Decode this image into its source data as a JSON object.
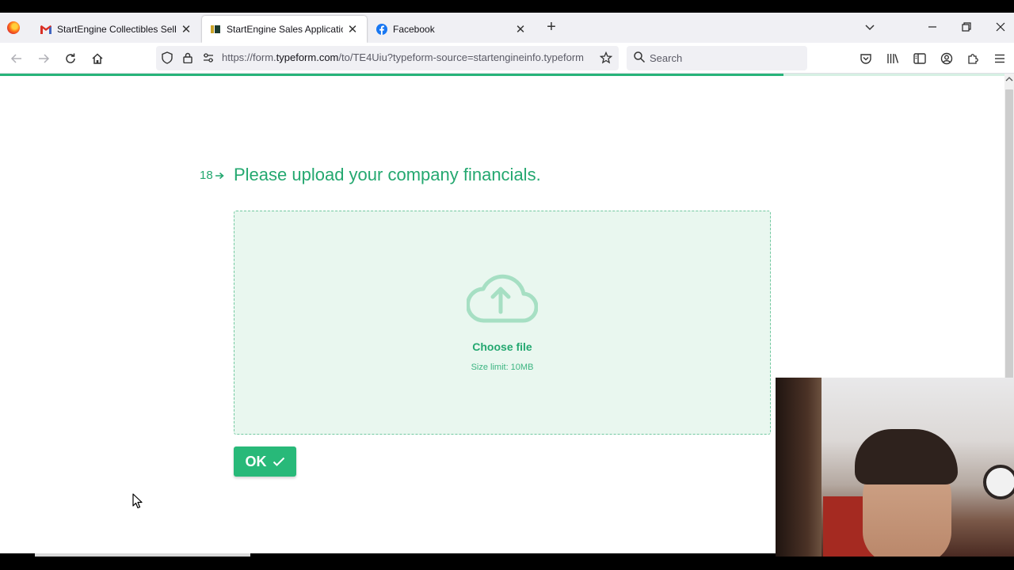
{
  "browser": {
    "tabs": [
      {
        "title": "StartEngine Collectibles Selling",
        "favicon": "gmail-icon"
      },
      {
        "title": "StartEngine Sales Application",
        "favicon": "startengine-icon"
      },
      {
        "title": "Facebook",
        "favicon": "facebook-icon"
      }
    ],
    "url": {
      "prefix": "https://form.",
      "host": "typeform.com",
      "path": "/to/TE4Uiu?typeform-source=startengineinfo.typeform"
    },
    "search_placeholder": "Search"
  },
  "form": {
    "progress_fraction": 0.78,
    "question_number": "18",
    "question_title": "Please upload your company financials.",
    "upload": {
      "choose_label": "Choose file",
      "size_limit": "Size limit: 10MB"
    },
    "ok_label": "OK"
  },
  "colors": {
    "accent": "#24a870",
    "dropzone_bg": "#e9f7ef",
    "button_bg": "#28b979"
  }
}
